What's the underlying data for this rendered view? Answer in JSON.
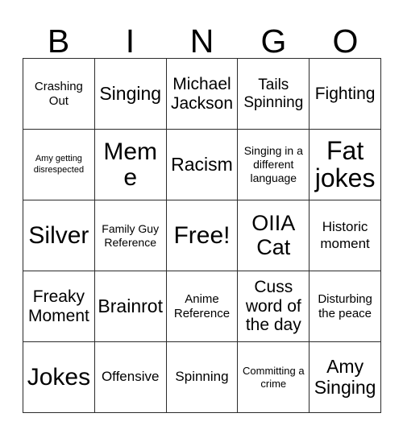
{
  "card": {
    "title": "BINGO",
    "header_letters": [
      "B",
      "I",
      "N",
      "G",
      "O"
    ],
    "free_space_label": "Free!",
    "colors": {
      "background": "#ffffff",
      "text": "#000000",
      "grid_line": "#2b2b2b"
    },
    "grid": {
      "columns": 5,
      "rows": 5
    },
    "cells": [
      {
        "text": "Crashing Out",
        "size": "md",
        "column": "B",
        "row": 1
      },
      {
        "text": "Singing",
        "size": "xxl",
        "column": "I",
        "row": 1
      },
      {
        "text": "Michael Jackson",
        "size": "xl",
        "column": "N",
        "row": 1
      },
      {
        "text": "Tails Spinning",
        "size": "lg",
        "column": "G",
        "row": 1
      },
      {
        "text": "Fighting",
        "size": "xl",
        "column": "O",
        "row": 1
      },
      {
        "text": "Amy getting disrespected",
        "size": "xs",
        "column": "B",
        "row": 2
      },
      {
        "text": "Meme",
        "size": "h2",
        "column": "I",
        "row": 2
      },
      {
        "text": "Racism",
        "size": "xxl",
        "column": "N",
        "row": 2
      },
      {
        "text": "Singing in a different language",
        "size": "smd",
        "column": "G",
        "row": 2
      },
      {
        "text": "Fat jokes",
        "size": "h3",
        "column": "O",
        "row": 2
      },
      {
        "text": "Silver",
        "size": "h2",
        "column": "B",
        "row": 3
      },
      {
        "text": "Family Guy Reference",
        "size": "smd",
        "column": "I",
        "row": 3
      },
      {
        "text": "Free!",
        "size": "h2",
        "column": "N",
        "row": 3
      },
      {
        "text": "OIIA Cat",
        "size": "h1",
        "column": "G",
        "row": 3
      },
      {
        "text": "Historic moment",
        "size": "mdl",
        "column": "O",
        "row": 3
      },
      {
        "text": "Freaky Moment",
        "size": "xl",
        "column": "B",
        "row": 4
      },
      {
        "text": "Brainrot",
        "size": "xxl",
        "column": "I",
        "row": 4
      },
      {
        "text": "Anime Reference",
        "size": "md",
        "column": "N",
        "row": 4
      },
      {
        "text": "Cuss word of the day",
        "size": "xl",
        "column": "G",
        "row": 4
      },
      {
        "text": "Disturbing the peace",
        "size": "md",
        "column": "O",
        "row": 4
      },
      {
        "text": "Jokes",
        "size": "h2",
        "column": "B",
        "row": 5
      },
      {
        "text": "Offensive",
        "size": "mdl",
        "column": "I",
        "row": 5
      },
      {
        "text": "Spinning",
        "size": "mdl",
        "column": "N",
        "row": 5
      },
      {
        "text": "Committing a crime",
        "size": "sm",
        "column": "G",
        "row": 5
      },
      {
        "text": "Amy Singing",
        "size": "xxl",
        "column": "O",
        "row": 5
      }
    ]
  }
}
